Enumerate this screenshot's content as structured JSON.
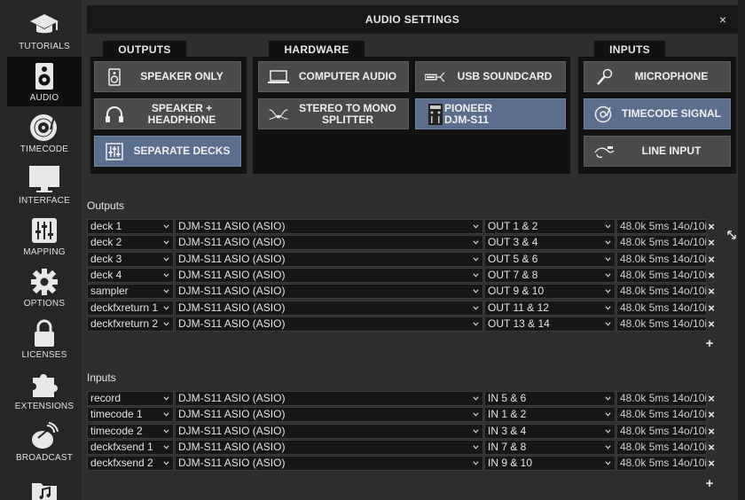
{
  "sidebar": {
    "items": [
      {
        "label": "TUTORIALS",
        "icon": "graduation-cap-icon",
        "active": false
      },
      {
        "label": "AUDIO",
        "icon": "speaker-icon",
        "active": true
      },
      {
        "label": "TIMECODE",
        "icon": "vinyl-icon",
        "active": false
      },
      {
        "label": "INTERFACE",
        "icon": "monitor-icon",
        "active": false
      },
      {
        "label": "MAPPING",
        "icon": "sliders-icon",
        "active": false
      },
      {
        "label": "OPTIONS",
        "icon": "gear-icon",
        "active": false
      },
      {
        "label": "LICENSES",
        "icon": "lock-icon",
        "active": false
      },
      {
        "label": "EXTENSIONS",
        "icon": "puzzle-icon",
        "active": false
      },
      {
        "label": "BROADCAST",
        "icon": "broadcast-icon",
        "active": false
      },
      {
        "label": "",
        "icon": "music-folder-icon",
        "active": false
      }
    ]
  },
  "window": {
    "title": "AUDIO SETTINGS",
    "close": "×"
  },
  "groups": {
    "outputs": {
      "title": "OUTPUTS",
      "buttons": [
        {
          "label": "SPEAKER ONLY",
          "icon": "speaker-icon",
          "selected": false
        },
        {
          "label": "SPEAKER +\nHEADPHONE",
          "icon": "headphones-icon",
          "selected": false
        },
        {
          "label": "SEPARATE DECKS",
          "icon": "mixer-icon",
          "selected": true
        }
      ]
    },
    "hardware": {
      "title": "HARDWARE",
      "buttons": [
        {
          "label": "COMPUTER AUDIO",
          "icon": "laptop-icon",
          "selected": false
        },
        {
          "label": "USB SOUNDCARD",
          "icon": "usb-icon",
          "selected": false
        },
        {
          "label": "STEREO TO MONO\nSPLITTER",
          "icon": "splitter-cable-icon",
          "selected": false
        },
        {
          "label": "PIONEER\nDJM-S11",
          "icon": "controller-icon",
          "selected": true
        }
      ]
    },
    "inputs": {
      "title": "INPUTS",
      "buttons": [
        {
          "label": "MICROPHONE",
          "icon": "microphone-icon",
          "selected": false
        },
        {
          "label": "TIMECODE SIGNAL",
          "icon": "timecode-vinyl-icon",
          "selected": true
        },
        {
          "label": "LINE INPUT",
          "icon": "line-cable-icon",
          "selected": false
        }
      ]
    }
  },
  "outputs_section": {
    "label": "Outputs",
    "rows": [
      {
        "name": "deck 1",
        "device": "DJM-S11 ASIO (ASIO)",
        "channel": "OUT 1 & 2",
        "info": "48.0k 5ms 14o/10i"
      },
      {
        "name": "deck 2",
        "device": "DJM-S11 ASIO (ASIO)",
        "channel": "OUT 3 & 4",
        "info": "48.0k 5ms 14o/10i"
      },
      {
        "name": "deck 3",
        "device": "DJM-S11 ASIO (ASIO)",
        "channel": "OUT 5 & 6",
        "info": "48.0k 5ms 14o/10i"
      },
      {
        "name": "deck 4",
        "device": "DJM-S11 ASIO (ASIO)",
        "channel": "OUT 7 & 8",
        "info": "48.0k 5ms 14o/10i"
      },
      {
        "name": "sampler",
        "device": "DJM-S11 ASIO (ASIO)",
        "channel": "OUT 9 & 10",
        "info": "48.0k 5ms 14o/10i"
      },
      {
        "name": "deckfxreturn 1",
        "device": "DJM-S11 ASIO (ASIO)",
        "channel": "OUT 11 & 12",
        "info": "48.0k 5ms 14o/10i"
      },
      {
        "name": "deckfxreturn 2",
        "device": "DJM-S11 ASIO (ASIO)",
        "channel": "OUT 13 & 14",
        "info": "48.0k 5ms 14o/10i"
      }
    ],
    "add": "+"
  },
  "inputs_section": {
    "label": "Inputs",
    "rows": [
      {
        "name": "record",
        "device": "DJM-S11 ASIO (ASIO)",
        "channel": "IN 5 & 6",
        "info": "48.0k 5ms 14o/10i"
      },
      {
        "name": "timecode 1",
        "device": "DJM-S11 ASIO (ASIO)",
        "channel": "IN 1 & 2",
        "info": "48.0k 5ms 14o/10i"
      },
      {
        "name": "timecode 2",
        "device": "DJM-S11 ASIO (ASIO)",
        "channel": "IN 3 & 4",
        "info": "48.0k 5ms 14o/10i"
      },
      {
        "name": "deckfxsend 1",
        "device": "DJM-S11 ASIO (ASIO)",
        "channel": "IN 7 & 8",
        "info": "48.0k 5ms 14o/10i"
      },
      {
        "name": "deckfxsend 2",
        "device": "DJM-S11 ASIO (ASIO)",
        "channel": "IN 9 & 10",
        "info": "48.0k 5ms 14o/10i"
      }
    ],
    "add": "+"
  },
  "row_delete": "×",
  "colors": {
    "selected": "#5a6f8e",
    "button": "#4a4a4a",
    "panel": "#111111",
    "titlebar": "#171717"
  }
}
